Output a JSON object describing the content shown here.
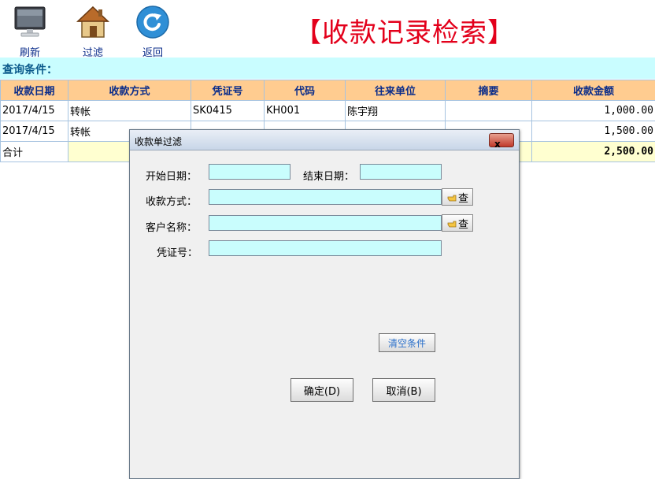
{
  "toolbar": {
    "refresh_label": "刷新",
    "filter_label": "过滤",
    "back_label": "返回"
  },
  "title": "【收款记录检索】",
  "query_label": "查询条件：",
  "table": {
    "headers": [
      "收款日期",
      "收款方式",
      "凭证号",
      "代码",
      "往来单位",
      "摘要",
      "收款金额"
    ],
    "rows": [
      {
        "date": "2017/4/15",
        "method": "转帐",
        "voucher": "SK0415",
        "code": "KH001",
        "unit": "陈宇翔",
        "summary": "",
        "amount": "1,000.00"
      },
      {
        "date": "2017/4/15",
        "method": "转帐",
        "voucher": "",
        "code": "",
        "unit": "",
        "summary": "",
        "amount": "1,500.00"
      }
    ],
    "total_label": "合计",
    "total_amount": "2,500.00"
  },
  "dialog": {
    "title": "收款单过滤",
    "close_label": "x",
    "start_date_label": "开始日期：",
    "start_date_value": "",
    "end_date_label": "结束日期：",
    "end_date_value": "",
    "method_label": "收款方式：",
    "method_value": "",
    "customer_label": "客户名称：",
    "customer_value": "",
    "voucher_label": "凭证号：",
    "voucher_value": "",
    "lookup_label": "查",
    "clear_label": "清空条件",
    "ok_label": "确定(D)",
    "cancel_label": "取消(B)"
  },
  "colors": {
    "title_red": "#e3001b",
    "header_bg": "#ffcc90",
    "input_bg": "#c9fdfd",
    "query_bg": "#c9fdff"
  }
}
